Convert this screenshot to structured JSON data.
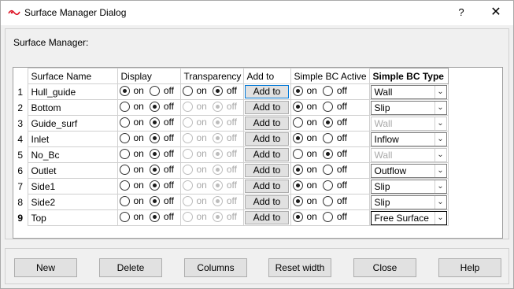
{
  "window": {
    "title": "Surface Manager Dialog",
    "help_label": "?",
    "close_label": "✕"
  },
  "group": {
    "label": "Surface Manager:"
  },
  "columns": {
    "name": "Surface Name",
    "display": "Display",
    "transparency": "Transparency",
    "add_to": "Add to",
    "bc_active": "Simple BC Active",
    "bc_type": "Simple BC Type"
  },
  "radio_labels": {
    "on": "on",
    "off": "off"
  },
  "add_to_label": "Add to",
  "rows": [
    {
      "num": "1",
      "name": "Hull_guide",
      "display": "on",
      "transparency": "off",
      "transparency_enabled": true,
      "bc_active": "on",
      "bc_type": "Wall",
      "bc_type_enabled": true
    },
    {
      "num": "2",
      "name": "Bottom",
      "display": "off",
      "transparency": "off",
      "transparency_enabled": false,
      "bc_active": "on",
      "bc_type": "Slip",
      "bc_type_enabled": true
    },
    {
      "num": "3",
      "name": "Guide_surf",
      "display": "off",
      "transparency": "off",
      "transparency_enabled": false,
      "bc_active": "off",
      "bc_type": "Wall",
      "bc_type_enabled": false
    },
    {
      "num": "4",
      "name": "Inlet",
      "display": "off",
      "transparency": "off",
      "transparency_enabled": false,
      "bc_active": "on",
      "bc_type": "Inflow",
      "bc_type_enabled": true
    },
    {
      "num": "5",
      "name": "No_Bc",
      "display": "off",
      "transparency": "off",
      "transparency_enabled": false,
      "bc_active": "off",
      "bc_type": "Wall",
      "bc_type_enabled": false
    },
    {
      "num": "6",
      "name": "Outlet",
      "display": "off",
      "transparency": "off",
      "transparency_enabled": false,
      "bc_active": "on",
      "bc_type": "Outflow",
      "bc_type_enabled": true
    },
    {
      "num": "7",
      "name": "Side1",
      "display": "off",
      "transparency": "off",
      "transparency_enabled": false,
      "bc_active": "on",
      "bc_type": "Slip",
      "bc_type_enabled": true
    },
    {
      "num": "8",
      "name": "Side2",
      "display": "off",
      "transparency": "off",
      "transparency_enabled": false,
      "bc_active": "on",
      "bc_type": "Slip",
      "bc_type_enabled": true
    },
    {
      "num": "9",
      "name": "Top",
      "display": "off",
      "transparency": "off",
      "transparency_enabled": false,
      "bc_active": "on",
      "bc_type": "Free Surface",
      "bc_type_enabled": true
    }
  ],
  "buttons": {
    "new": "New",
    "delete": "Delete",
    "columns": "Columns",
    "reset_width": "Reset width",
    "close": "Close",
    "help": "Help"
  }
}
